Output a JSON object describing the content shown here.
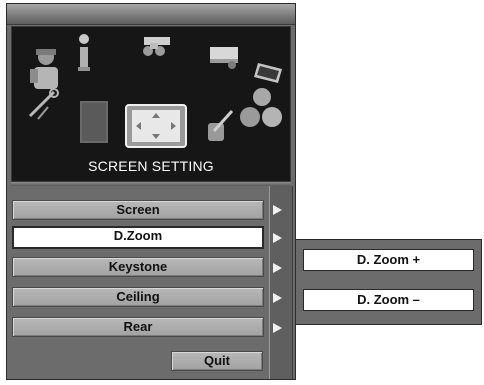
{
  "header": {
    "title": "SCREEN SETTING"
  },
  "icons": [
    "person-icon",
    "info-icon",
    "projector-icon",
    "screen-settings-icon",
    "laptop-icon",
    "wrench-icon",
    "book-icon",
    "screen-adjust-icon",
    "tools-icon",
    "balls-icon"
  ],
  "menu": {
    "items": [
      {
        "label": "Screen",
        "selected": false
      },
      {
        "label": "D.Zoom",
        "selected": true
      },
      {
        "label": "Keystone",
        "selected": false
      },
      {
        "label": "Ceiling",
        "selected": false
      },
      {
        "label": "Rear",
        "selected": false
      }
    ],
    "quit_label": "Quit"
  },
  "submenu": {
    "items": [
      {
        "label": "D. Zoom +"
      },
      {
        "label": "D. Zoom –"
      }
    ]
  },
  "colors": {
    "panel": "#6c6c6c",
    "icon_background": "#161616",
    "selected": "#ffffff"
  }
}
